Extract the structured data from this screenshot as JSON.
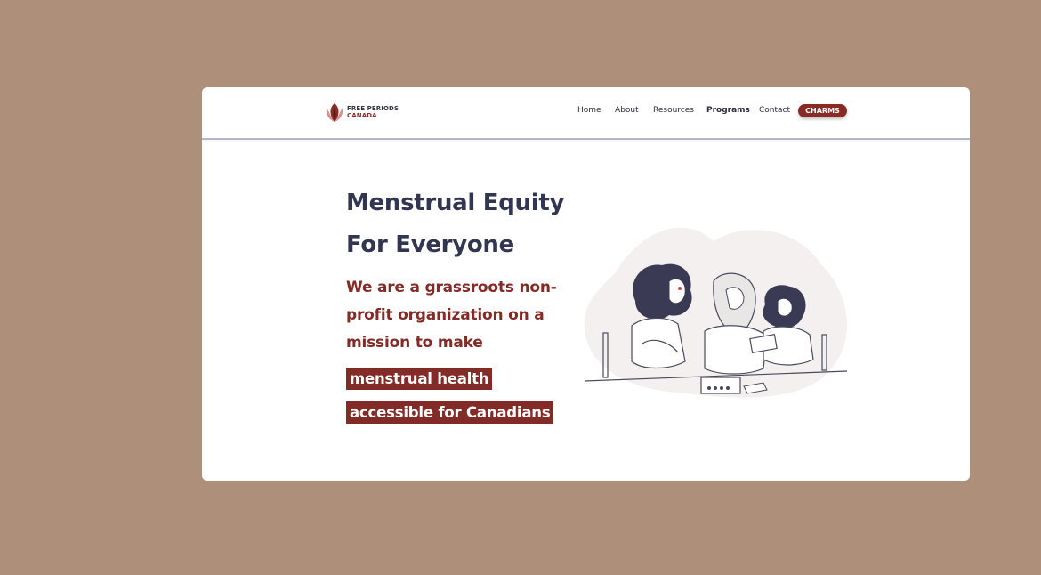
{
  "header": {
    "logo": {
      "line1": "FREE PERIODS",
      "line2": "CANADA"
    },
    "nav": [
      {
        "label": "Home"
      },
      {
        "label": "About"
      },
      {
        "label": "Resources"
      },
      {
        "label": "Programs"
      },
      {
        "label": "Contact"
      }
    ],
    "cta_label": "CHARMS"
  },
  "hero": {
    "title_line1": "Menstrual Equity",
    "title_line2": "For Everyone",
    "subtitle_line1": "We are a grassroots non-",
    "subtitle_line2": "profit organization on a",
    "subtitle_line3": "mission to make",
    "highlight_line1": "menstrual health",
    "highlight_line2": "accessible for Canadians"
  },
  "colors": {
    "background": "#ae8f7a",
    "brand_red": "#832b27",
    "heading": "#323651"
  },
  "illustration": {
    "icon": "family-at-table-illustration"
  }
}
